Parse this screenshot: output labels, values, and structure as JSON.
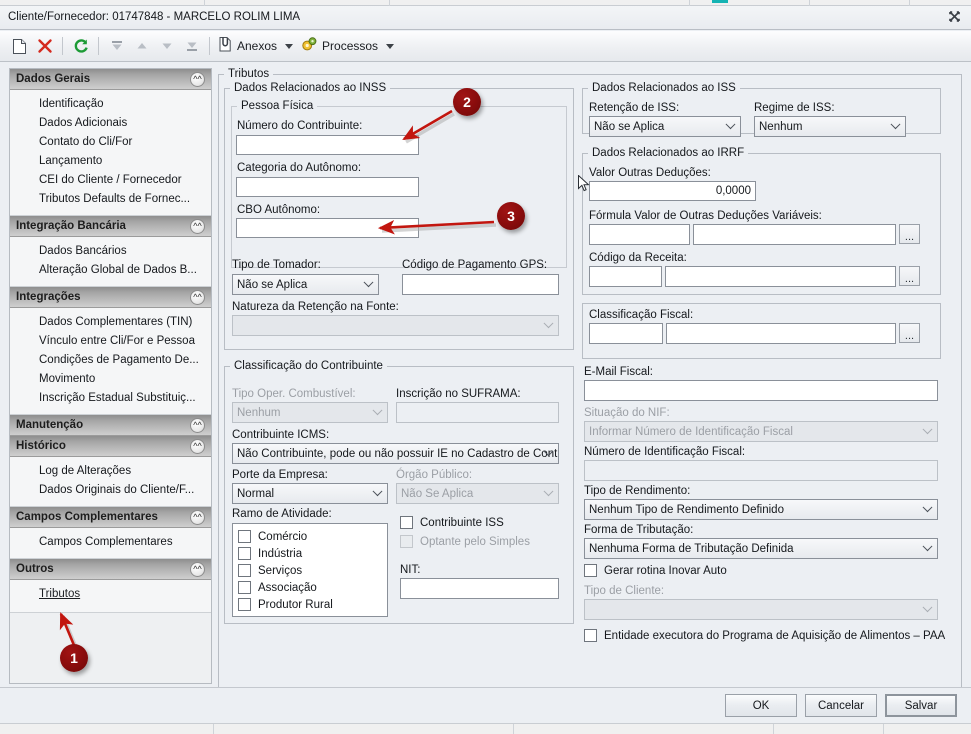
{
  "window": {
    "title": "Cliente/Fornecedor: 01747848 - MARCELO ROLIM LIMA",
    "close_icon": "close-icon"
  },
  "toolbar": {
    "new_icon": "new-document-icon",
    "delete_icon": "delete-x-icon",
    "refresh_icon": "refresh-icon",
    "first_icon": "first-record-icon",
    "prev_icon": "previous-record-icon",
    "next_icon": "next-record-icon",
    "last_icon": "last-record-icon",
    "attachments_label": "Anexos",
    "attachments_icon": "paperclip-icon",
    "processes_label": "Processos",
    "processes_icon": "gears-icon"
  },
  "sidebar": {
    "sections": [
      {
        "title": "Dados Gerais",
        "expanded": true,
        "items": [
          "Identificação",
          "Dados Adicionais",
          "Contato do Cli/For",
          "Lançamento",
          "CEI do Cliente /  Fornecedor",
          "Tributos Defaults de Fornec..."
        ]
      },
      {
        "title": "Integração Bancária",
        "expanded": true,
        "items": [
          "Dados Bancários",
          "Alteração Global de Dados B..."
        ]
      },
      {
        "title": "Integrações",
        "expanded": true,
        "items": [
          "Dados Complementares (TIN)",
          "Vínculo entre Cli/For e Pessoa",
          "Condições de Pagamento De...",
          "Movimento",
          "Inscrição Estadual Substituiç..."
        ]
      },
      {
        "title": "Manutenção",
        "expanded": false,
        "items": []
      },
      {
        "title": "Histórico",
        "expanded": true,
        "items": [
          "Log de Alterações",
          "Dados Originais do Cliente/F..."
        ]
      },
      {
        "title": "Campos Complementares",
        "expanded": true,
        "items": [
          "Campos Complementares"
        ]
      },
      {
        "title": "Outros",
        "expanded": true,
        "items": [
          "Tributos"
        ]
      }
    ]
  },
  "main": {
    "group_tributos": "Tributos",
    "inss": {
      "legend": "Dados Relacionados ao INSS",
      "pessoa_fisica": {
        "legend": "Pessoa Física",
        "numero_contribuinte_label": "Número do Contribuinte:",
        "numero_contribuinte_value": "",
        "categoria_autonomo_label": "Categoria do Autônomo:",
        "categoria_autonomo_value": "",
        "cbo_autonomo_label": "CBO Autônomo:",
        "cbo_autonomo_value": ""
      },
      "tipo_tomador_label": "Tipo de Tomador:",
      "tipo_tomador_value": "Não se Aplica",
      "codigo_gps_label": "Código de Pagamento GPS:",
      "codigo_gps_value": "",
      "natureza_retencao_label": "Natureza da Retenção na Fonte:",
      "natureza_retencao_value": ""
    },
    "classificacao": {
      "legend": "Classificação do Contribuinte",
      "tipo_oper_label": "Tipo Oper. Combustível:",
      "tipo_oper_value": "Nenhum",
      "suframa_label": "Inscrição no SUFRAMA:",
      "suframa_value": "",
      "contribuinte_icms_label": "Contribuinte ICMS:",
      "contribuinte_icms_value": "Não Contribuinte, pode ou não possuir IE no Cadastro de Contribu",
      "porte_empresa_label": "Porte da Empresa:",
      "porte_empresa_value": "Normal",
      "orgao_publico_label": "Órgão Público:",
      "orgao_publico_value": "Não Se Aplica",
      "ramo_atividade_label": "Ramo de Atividade:",
      "ramo_atividade_items": [
        "Comércio",
        "Indústria",
        "Serviços",
        "Associação",
        "Produtor Rural"
      ],
      "contribuinte_iss_label": "Contribuinte ISS",
      "optante_simples_label": "Optante pelo Simples",
      "nit_label": "NIT:",
      "nit_value": ""
    },
    "iss": {
      "legend": "Dados Relacionados ao ISS",
      "retencao_label": "Retenção de ISS:",
      "retencao_value": "Não se Aplica",
      "regime_label": "Regime de ISS:",
      "regime_value": "Nenhum"
    },
    "irrf": {
      "legend": "Dados Relacionados ao IRRF",
      "valor_outras_deducoes_label": "Valor Outras Deduções:",
      "valor_outras_deducoes_value": "0,0000",
      "formula_label": "Fórmula Valor de Outras Deduções Variáveis:",
      "formula_code": "",
      "formula_desc": "",
      "codigo_receita_label": "Código da Receita:",
      "codigo_receita_code": "",
      "codigo_receita_desc": "",
      "ellipsis_label": "..."
    },
    "fiscal": {
      "classificacao_fiscal_label": "Classificação Fiscal:",
      "classificacao_fiscal_code": "",
      "classificacao_fiscal_desc": "",
      "email_fiscal_label": "E-Mail Fiscal:",
      "email_fiscal_value": "",
      "situacao_nif_label": "Situação do NIF:",
      "situacao_nif_value": "Informar Número de Identificação Fiscal",
      "numero_nif_label": "Número de Identificação Fiscal:",
      "numero_nif_value": "",
      "tipo_rendimento_label": "Tipo de Rendimento:",
      "tipo_rendimento_value": "Nenhum Tipo de Rendimento Definido",
      "forma_tributacao_label": "Forma de Tributação:",
      "forma_tributacao_value": "Nenhuma Forma de Tributação Definida",
      "gerar_inovar_label": "Gerar rotina Inovar Auto",
      "tipo_cliente_label": "Tipo de Cliente:",
      "tipo_cliente_value": "",
      "entidade_paa_label": "Entidade executora do Programa de Aquisição de Alimentos – PAA"
    }
  },
  "footer": {
    "ok_label": "OK",
    "cancel_label": "Cancelar",
    "save_label": "Salvar"
  },
  "annotations": {
    "markers": [
      {
        "number": "1",
        "target": "sidebar-item-tributos"
      },
      {
        "number": "2",
        "target": "numero-contribuinte-input"
      },
      {
        "number": "3",
        "target": "cbo-autonomo-input"
      }
    ],
    "accent_color": "#8d0d0d"
  }
}
